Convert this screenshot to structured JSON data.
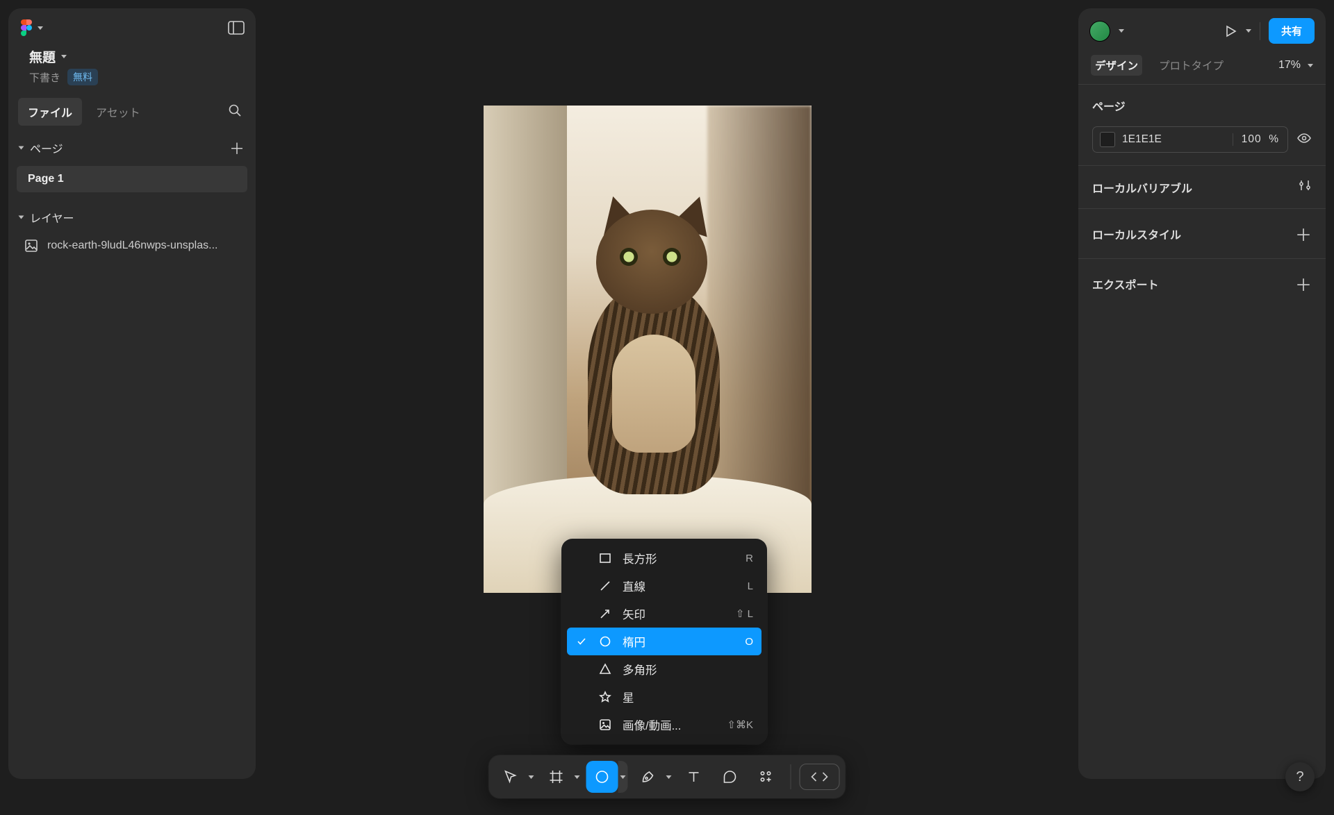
{
  "doc": {
    "title": "無題",
    "status": "下書き",
    "plan_badge": "無料"
  },
  "left_tabs": {
    "file": "ファイル",
    "assets": "アセット"
  },
  "pages_section": "ページ",
  "pages": [
    "Page 1"
  ],
  "layers_section": "レイヤー",
  "layers": [
    "rock-earth-9ludL46nwps-unsplas..."
  ],
  "right_header": {
    "share": "共有"
  },
  "right_tabs": {
    "design": "デザイン",
    "prototype": "プロトタイプ",
    "zoom": "17%"
  },
  "page_panel": {
    "title": "ページ",
    "bg_hex": "1E1E1E",
    "opacity_value": "100",
    "opacity_unit": "%"
  },
  "local_variables": "ローカルバリアブル",
  "local_styles": "ローカルスタイル",
  "export": "エクスポート",
  "shape_menu": [
    {
      "icon": "rectangle",
      "label": "長方形",
      "shortcut": "R",
      "selected": false
    },
    {
      "icon": "line",
      "label": "直線",
      "shortcut": "L",
      "selected": false
    },
    {
      "icon": "arrow",
      "label": "矢印",
      "shortcut": "⇧ L",
      "selected": false
    },
    {
      "icon": "ellipse",
      "label": "楕円",
      "shortcut": "O",
      "selected": true
    },
    {
      "icon": "polygon",
      "label": "多角形",
      "shortcut": "",
      "selected": false
    },
    {
      "icon": "star",
      "label": "星",
      "shortcut": "",
      "selected": false
    },
    {
      "icon": "image",
      "label": "画像/動画...",
      "shortcut": "⇧⌘K",
      "selected": false
    }
  ],
  "help": "?"
}
